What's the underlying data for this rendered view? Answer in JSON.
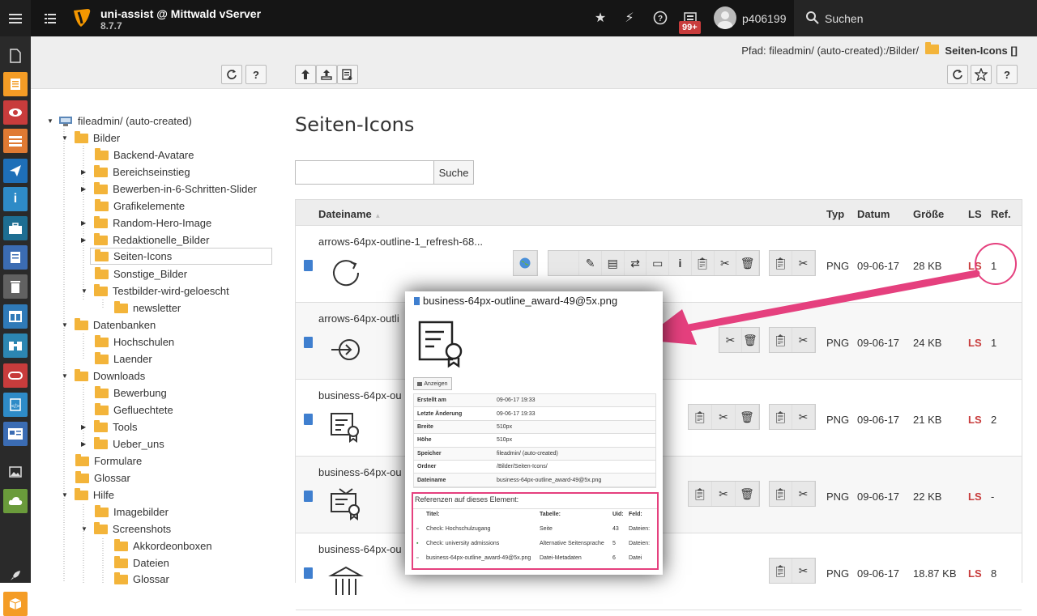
{
  "topbar": {
    "site_name": "uni-assist @ Mittwald vServer",
    "version": "8.7.7",
    "notification_count": "99+",
    "username": "p406199",
    "search_label": "Suchen"
  },
  "path": {
    "prefix": "Pfad: fileadmin/ (auto-created):/Bilder/",
    "current": "Seiten-Icons []"
  },
  "tree": {
    "root": "fileadmin/ (auto-created)",
    "items": [
      {
        "label": "Bilder"
      },
      {
        "label": "Backend-Avatare"
      },
      {
        "label": "Bereichseinstieg"
      },
      {
        "label": "Bewerben-in-6-Schritten-Slider"
      },
      {
        "label": "Grafikelemente"
      },
      {
        "label": "Random-Hero-Image"
      },
      {
        "label": "Redaktionelle_Bilder"
      },
      {
        "label": "Seiten-Icons"
      },
      {
        "label": "Sonstige_Bilder"
      },
      {
        "label": "Testbilder-wird-geloescht"
      },
      {
        "label": "newsletter"
      },
      {
        "label": "Datenbanken"
      },
      {
        "label": "Hochschulen"
      },
      {
        "label": "Laender"
      },
      {
        "label": "Downloads"
      },
      {
        "label": "Bewerbung"
      },
      {
        "label": "Gefluechtete"
      },
      {
        "label": "Tools"
      },
      {
        "label": "Ueber_uns"
      },
      {
        "label": "Formulare"
      },
      {
        "label": "Glossar"
      },
      {
        "label": "Hilfe"
      },
      {
        "label": "Imagebilder"
      },
      {
        "label": "Screenshots"
      },
      {
        "label": "Akkordeonboxen"
      },
      {
        "label": "Dateien"
      },
      {
        "label": "Glossar"
      }
    ]
  },
  "main": {
    "title": "Seiten-Icons",
    "search_button": "Suche",
    "columns": {
      "name": "Dateiname",
      "type": "Typ",
      "date": "Datum",
      "size": "Größe",
      "ls": "LS",
      "ref": "Ref."
    },
    "rows": [
      {
        "name": "arrows-64px-outline-1_refresh-68...",
        "type": "PNG",
        "date": "09-06-17",
        "size": "28 KB",
        "ls": "LS",
        "ref": "1"
      },
      {
        "name": "arrows-64px-outli",
        "type": "PNG",
        "date": "09-06-17",
        "size": "24 KB",
        "ls": "LS",
        "ref": "1"
      },
      {
        "name": "business-64px-ou",
        "type": "PNG",
        "date": "09-06-17",
        "size": "21 KB",
        "ls": "LS",
        "ref": "2"
      },
      {
        "name": "business-64px-ou",
        "type": "PNG",
        "date": "09-06-17",
        "size": "22 KB",
        "ls": "LS",
        "ref": "-"
      },
      {
        "name": "business-64px-ou",
        "type": "PNG",
        "date": "09-06-17",
        "size": "18.87 KB",
        "ls": "LS",
        "ref": "8"
      }
    ]
  },
  "popup": {
    "title": "business-64px-outline_award-49@5x.png",
    "show_button": "Anzeigen",
    "meta": [
      {
        "key": "Erstellt am",
        "value": "09-06-17 19:33"
      },
      {
        "key": "Letzte Änderung",
        "value": "09-06-17 19:33"
      },
      {
        "key": "Breite",
        "value": "510px"
      },
      {
        "key": "Höhe",
        "value": "510px"
      },
      {
        "key": "Speicher",
        "value": "fileadmin/ (auto-created)"
      },
      {
        "key": "Ordner",
        "value": "/Bilder/Seiten-Icons/"
      },
      {
        "key": "Dateiname",
        "value": "business-64px-outline_award-49@5x.png"
      }
    ],
    "references": {
      "title": "Referenzen auf dieses Element:",
      "headers": {
        "title": "Titel:",
        "table": "Tabelle:",
        "uid": "Uid:",
        "field": "Feld:"
      },
      "rows": [
        {
          "title": "Check: Hochschulzugang",
          "table": "Seite",
          "uid": "43",
          "field": "Dateien:"
        },
        {
          "title": "Check: university admissions",
          "table": "Alternative Seitensprache",
          "uid": "5",
          "field": "Dateien:"
        },
        {
          "title": "business-64px-outline_award-49@5x.png",
          "table": "Datei-Metadaten",
          "uid": "6",
          "field": "Datei"
        }
      ]
    }
  }
}
